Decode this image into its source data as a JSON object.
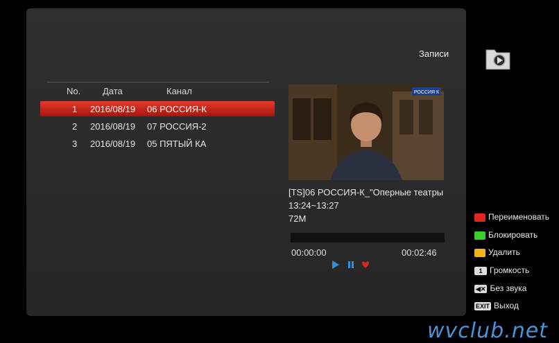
{
  "header": {
    "title": "Записи"
  },
  "list": {
    "columns": [
      "No.",
      "Дата",
      "Канал"
    ],
    "rows": [
      {
        "no": "1",
        "date": "2016/08/19",
        "channel": "06 РОССИЯ-К"
      },
      {
        "no": "2",
        "date": "2016/08/19",
        "channel": "07 РОССИЯ-2"
      },
      {
        "no": "3",
        "date": "2016/08/19",
        "channel": "05 ПЯТЫЙ КА"
      }
    ],
    "selected_index": 0
  },
  "preview": {
    "channel_logo": "РОССИЯ К"
  },
  "info": {
    "title": "[TS]06 РОССИЯ-К_\"Оперные театры",
    "time_range": "13:24~13:27",
    "size": "72M"
  },
  "playback": {
    "current": "00:00:00",
    "total": "00:02:46",
    "progress": 0.0
  },
  "legend": [
    {
      "key": "red",
      "color": "#e0281e",
      "label": "Переименовать"
    },
    {
      "key": "green",
      "color": "#3bcf2a",
      "label": "Блокировать"
    },
    {
      "key": "yellow",
      "color": "#f2b21c",
      "label": "Удалить"
    },
    {
      "key": "1",
      "label": "Громкость"
    },
    {
      "key": "mute",
      "label": "Без звука"
    },
    {
      "key": "EXIT",
      "label": "Выход"
    }
  ],
  "watermark": "wvclub.net"
}
